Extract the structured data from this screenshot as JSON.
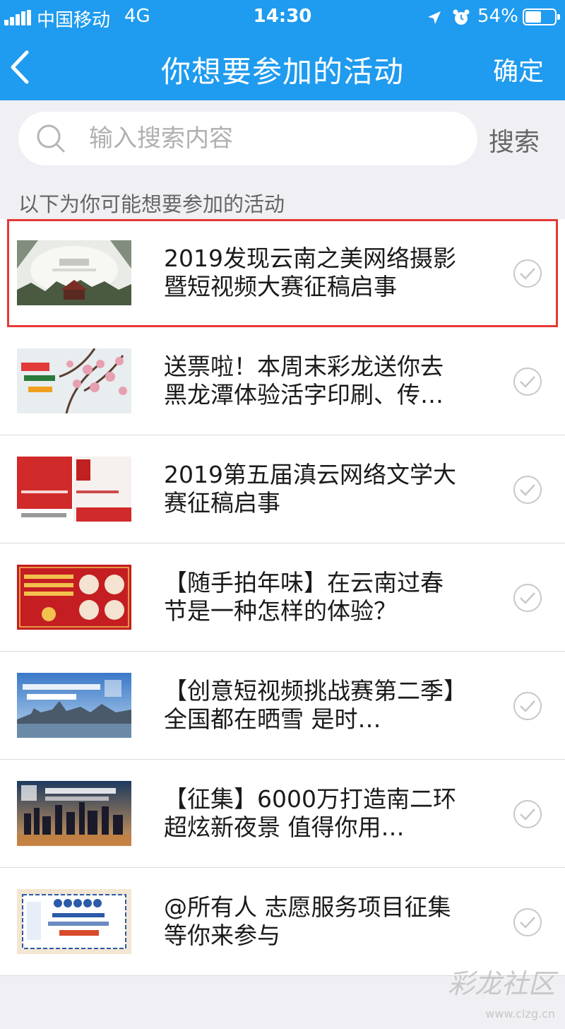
{
  "status_bar": {
    "carrier": "中国移动",
    "network": "4G",
    "time": "14:30",
    "battery_percent": "54%",
    "battery_level": 0.54,
    "icons": [
      "signal-icon",
      "location-icon",
      "alarm-icon",
      "battery-icon"
    ]
  },
  "nav": {
    "back_icon": "chevron-left-icon",
    "title": "你想要参加的活动",
    "confirm_label": "确定"
  },
  "search": {
    "placeholder": "输入搜索内容",
    "value": "",
    "button_label": "搜索",
    "icon": "search-icon"
  },
  "section_label": "以下为你可能想要参加的活动",
  "activities": [
    {
      "title": "2019发现云南之美网络摄影暨短视频大赛征稿启事",
      "selected": true
    },
    {
      "title": "送票啦！本周末彩龙送你去黑龙潭体验活字印刷、传…",
      "selected": false
    },
    {
      "title": "2019第五届滇云网络文学大赛征稿启事",
      "selected": false
    },
    {
      "title": "【随手拍年味】在云南过春节是一种怎样的体验？",
      "selected": false
    },
    {
      "title": "【创意短视频挑战赛第二季】全国都在晒雪 是时…",
      "selected": false
    },
    {
      "title": "【征集】6000万打造南二环超炫新夜景 值得你用…",
      "selected": false
    },
    {
      "title": "@所有人 志愿服务项目征集等你来参与",
      "selected": false
    }
  ],
  "colors": {
    "brand_blue": "#1f9bef",
    "selected_border": "#e53935",
    "check_gray": "#c8c8c8"
  },
  "watermark": {
    "text": "彩龙社区",
    "url": "www.clzg.cn"
  }
}
